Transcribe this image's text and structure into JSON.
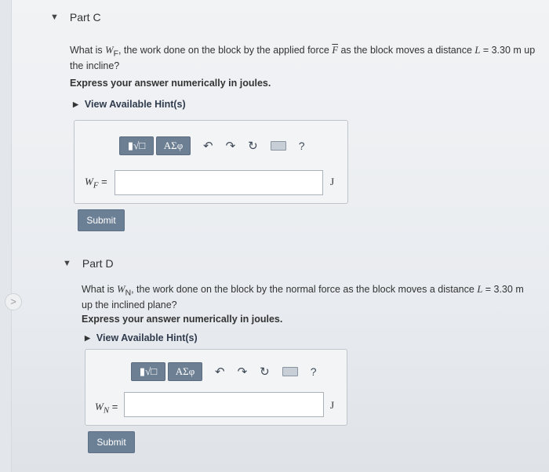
{
  "nav": {
    "arrow": ">"
  },
  "partC": {
    "caret": "▼",
    "title": "Part C",
    "question_pre": "What is ",
    "question_var": "W",
    "question_sub": "F",
    "question_mid": ", the work done on the block by the applied force ",
    "question_force": "F",
    "question_post": " as the block moves a distance ",
    "question_L": "L",
    "question_value": " = 3.30 m up the incline?",
    "instruction": "Express your answer numerically in joules.",
    "hint": "View Available Hint(s)",
    "toolbar": {
      "btn1": "▮√□",
      "btn2": "ΑΣφ",
      "undo": "↶",
      "redo": "↷",
      "reset": "↻",
      "help": "?"
    },
    "label": "W",
    "label_sub": "F",
    "label_eq": " =",
    "input_value": "",
    "unit": "J",
    "submit": "Submit"
  },
  "partD": {
    "caret": "▼",
    "title": "Part D",
    "question_pre": "What is ",
    "question_var": "W",
    "question_sub": "N",
    "question_mid": ", the work done on the block by the normal force as the block moves a distance ",
    "question_L": "L",
    "question_value": " = 3.30 m up the inclined plane?",
    "instruction": "Express your answer numerically in joules.",
    "hint": "View Available Hint(s)",
    "toolbar": {
      "btn1": "▮√□",
      "btn2": "ΑΣφ",
      "undo": "↶",
      "redo": "↷",
      "reset": "↻",
      "help": "?"
    },
    "label": "W",
    "label_sub": "N",
    "label_eq": " =",
    "input_value": "",
    "unit": "J",
    "submit": "Submit"
  }
}
